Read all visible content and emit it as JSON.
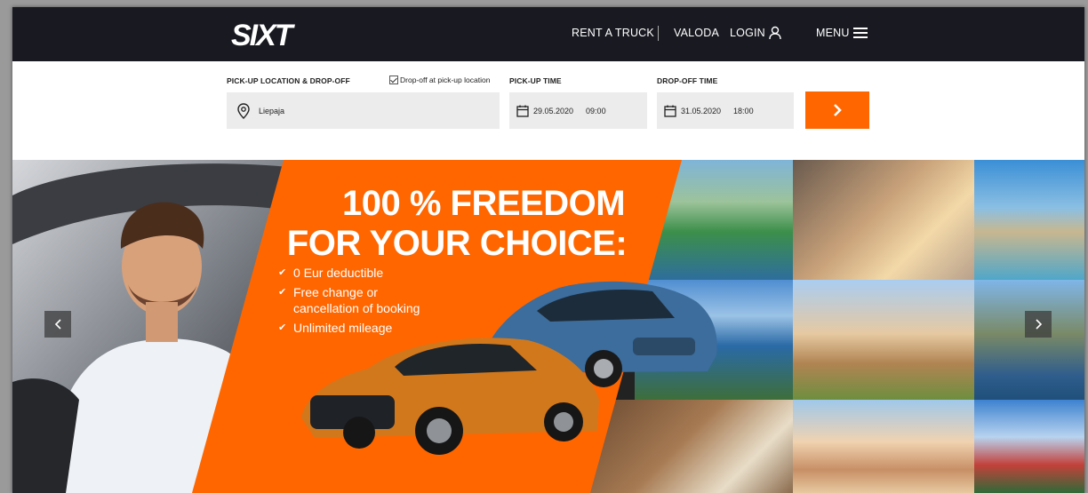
{
  "header": {
    "logo_text": "SIXT",
    "nav": {
      "rent_truck": "RENT A TRUCK",
      "language": "VALODA",
      "login": "LOGIN",
      "menu": "MENU"
    }
  },
  "booking": {
    "pickup_location_label": "PICK-UP LOCATION & DROP-OFF",
    "dropoff_same_label": "Drop-off at pick-up location",
    "dropoff_same_checked": true,
    "location_value": "Liepaja",
    "pickup_time_label": "PICK-UP TIME",
    "pickup_date": "29.05.2020",
    "pickup_hour": "09:00",
    "dropoff_time_label": "DROP-OFF TIME",
    "dropoff_date": "31.05.2020",
    "dropoff_hour": "18:00"
  },
  "hero": {
    "headline_line1": "100 % FREEDOM",
    "headline_line2": "FOR YOUR CHOICE:",
    "bullets": {
      "b1": "0 Eur deductible",
      "b2_line1": "Free change or",
      "b2_line2": "cancellation of booking",
      "b3": "Unlimited  mileage"
    }
  },
  "colors": {
    "header_bg": "#191a21",
    "accent_orange": "#ff6600",
    "field_bg": "#ececec"
  },
  "icons": [
    "sixt-logo",
    "user-icon",
    "hamburger-menu-icon",
    "location-pin-icon",
    "calendar-icon",
    "chevron-right-icon",
    "chevron-left-icon",
    "checkmark-icon"
  ]
}
